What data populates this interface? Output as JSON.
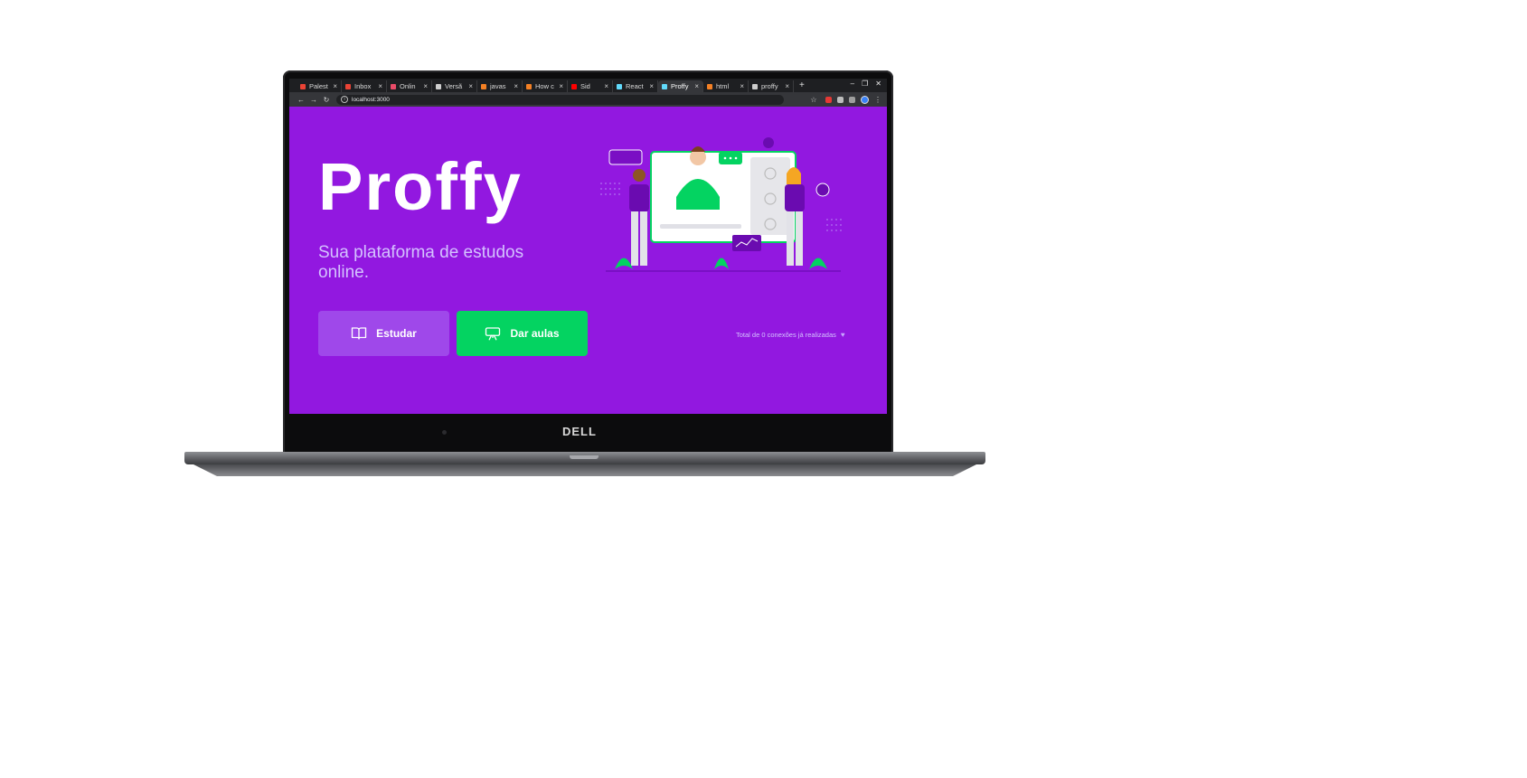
{
  "browser": {
    "tabs": [
      {
        "label": "Palest",
        "favicon_color": "#ea4335",
        "active": false
      },
      {
        "label": "Inbox",
        "favicon_color": "#ea4335",
        "active": false
      },
      {
        "label": "Onlin",
        "favicon_color": "#e94b68",
        "active": false
      },
      {
        "label": "Versã",
        "favicon_color": "#cfcfcf",
        "active": false
      },
      {
        "label": "javas",
        "favicon_color": "#f48024",
        "active": false
      },
      {
        "label": "How c",
        "favicon_color": "#f48024",
        "active": false
      },
      {
        "label": "Sid",
        "favicon_color": "#ff0000",
        "active": false
      },
      {
        "label": "React",
        "favicon_color": "#61dafb",
        "active": false
      },
      {
        "label": "Proffy",
        "favicon_color": "#61dafb",
        "active": true
      },
      {
        "label": "html",
        "favicon_color": "#f48024",
        "active": false
      },
      {
        "label": "proffy",
        "favicon_color": "#cccccc",
        "active": false
      }
    ],
    "tab_close": "×",
    "new_tab": "+",
    "url": "localhost:3000"
  },
  "page": {
    "logo": "Proffy",
    "tagline": "Sua plataforma de estudos online.",
    "study_button": "Estudar",
    "teach_button": "Dar aulas",
    "connections_text": "Total de 0 conexões já realizadas",
    "colors": {
      "background": "#9218e0",
      "primary_light": "#9f48ea",
      "secondary": "#04d361",
      "text_in_primary": "#d4c2ff"
    }
  },
  "laptop": {
    "brand": "DELL"
  }
}
